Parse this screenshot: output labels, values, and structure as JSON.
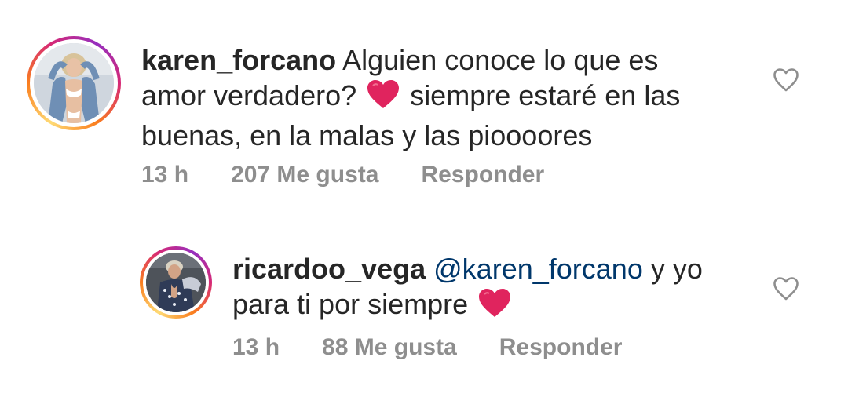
{
  "comments": [
    {
      "username": "karen_forcano",
      "text_before_heart": "Alguien conoce lo que es amor verdadero?",
      "text_after_heart": "siempre estaré en las buenas, en la malas y las pioooores",
      "time": "13 h",
      "likes": "207 Me gusta",
      "reply_label": "Responder",
      "avatar_icon": "profile-photo",
      "like_icon": "heart-outline-icon"
    },
    {
      "username": "ricardoo_vega",
      "mention": "@karen_forcano",
      "text_before_heart": "y yo para ti por siempre",
      "time": "13 h",
      "likes": "88 Me gusta",
      "reply_label": "Responder",
      "avatar_icon": "profile-photo",
      "like_icon": "heart-outline-icon"
    }
  ],
  "colors": {
    "text": "#262626",
    "meta": "#8e8e8e",
    "mention": "#00376b",
    "heart_emoji": "#e0245e"
  }
}
